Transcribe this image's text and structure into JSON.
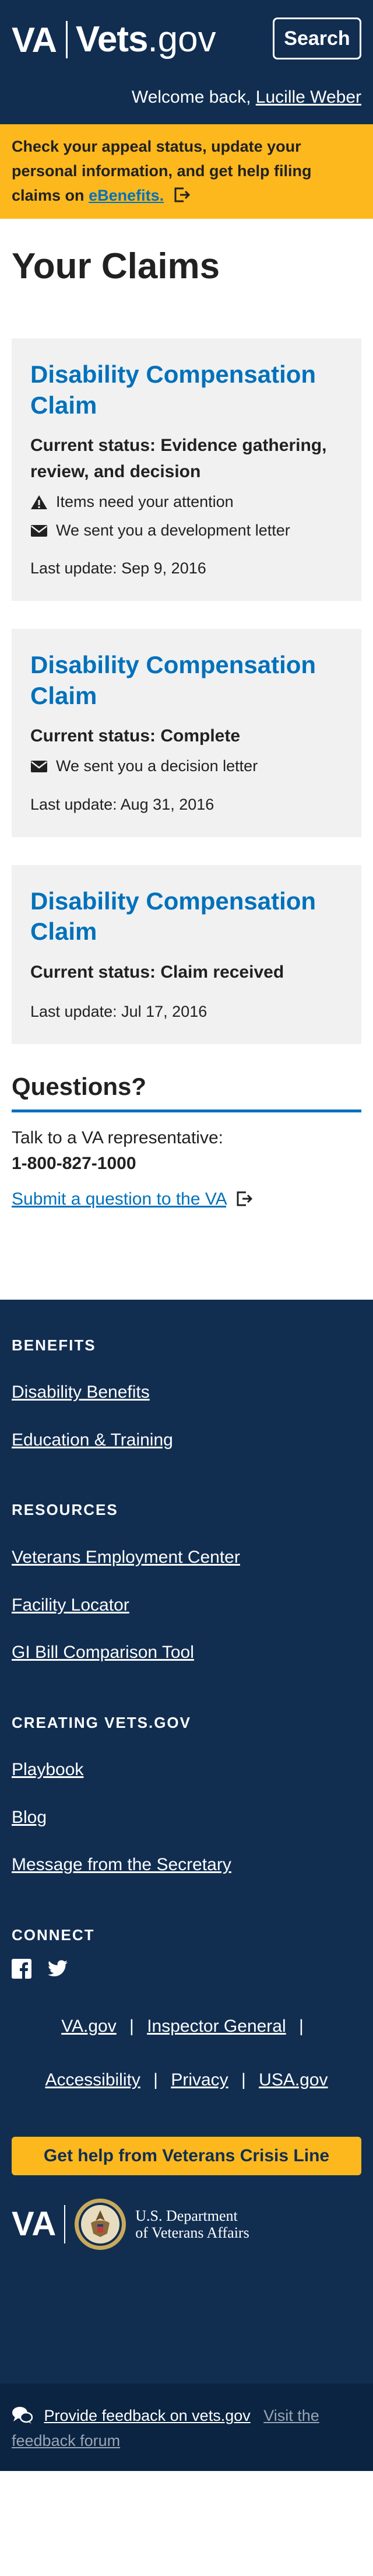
{
  "header": {
    "logo_va": "VA",
    "logo_vets": "Vets",
    "logo_gov": ".gov",
    "search_label": "Search",
    "welcome_prefix": "Welcome back,",
    "user_name": "Lucille Weber"
  },
  "alert": {
    "text": "Check your appeal status, update your personal information, and get help filing claims on",
    "link_text": "eBenefits."
  },
  "page": {
    "title": "Your Claims"
  },
  "claims": [
    {
      "title": "Disability Compensation Claim",
      "status": "Current status: Evidence gathering, review, and decision",
      "items": [
        {
          "icon": "warning-icon",
          "text": "Items need your attention"
        },
        {
          "icon": "envelope-icon",
          "text": "We sent you a development letter"
        }
      ],
      "updated": "Last update: Sep 9, 2016"
    },
    {
      "title": "Disability Compensation Claim",
      "status": "Current status: Complete",
      "items": [
        {
          "icon": "envelope-icon",
          "text": "We sent you a decision letter"
        }
      ],
      "updated": "Last update: Aug 31, 2016"
    },
    {
      "title": "Disability Compensation Claim",
      "status": "Current status: Claim received",
      "items": [],
      "updated": "Last update: Jul 17, 2016"
    }
  ],
  "questions": {
    "heading": "Questions?",
    "talk": "Talk to a VA representative:",
    "phone": "1-800-827-1000",
    "submit_link": "Submit a question to the VA"
  },
  "footer": {
    "sections": [
      {
        "heading": "BENEFITS",
        "links": [
          "Disability Benefits",
          "Education & Training"
        ]
      },
      {
        "heading": "RESOURCES",
        "links": [
          "Veterans Employment Center",
          "Facility Locator",
          "GI Bill Comparison Tool"
        ]
      },
      {
        "heading": "CREATING VETS.GOV",
        "links": [
          "Playbook",
          "Blog",
          "Message from the Secretary"
        ]
      }
    ],
    "connect_heading": "CONNECT",
    "social": [
      "facebook-icon",
      "twitter-icon"
    ],
    "links_row1": [
      "VA.gov",
      "Inspector General"
    ],
    "links_row2": [
      "Accessibility",
      "Privacy",
      "USA.gov"
    ],
    "separator": "|",
    "crisis_button": "Get help from Veterans Crisis Line",
    "dept_va": "VA",
    "dept_line1": "U.S. Department",
    "dept_line2": "of Veterans Affairs",
    "feedback_link": "Provide feedback on vets.gov",
    "forum_link": "Visit the feedback forum"
  },
  "colors": {
    "navy": "#112e51",
    "gold": "#fdb81e",
    "link_blue": "#0071bb",
    "card_gray": "#f1f1f1"
  }
}
